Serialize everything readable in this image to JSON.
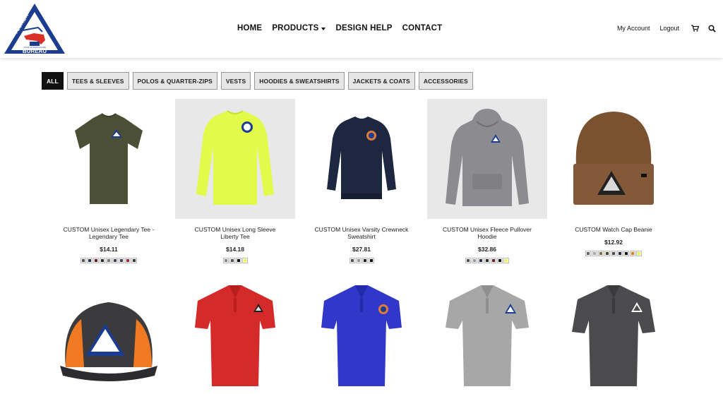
{
  "header": {
    "logo": {
      "top_text": "FLORIDA",
      "right_text": "FARM",
      "bottom_text": "BUREAU",
      "small_text": "VOICE OF AGRICULTURE"
    },
    "nav": [
      {
        "label": "HOME",
        "dropdown": false
      },
      {
        "label": "PRODUCTS",
        "dropdown": true
      },
      {
        "label": "DESIGN HELP",
        "dropdown": false
      },
      {
        "label": "CONTACT",
        "dropdown": false
      }
    ],
    "account_link": "My Account",
    "logout_link": "Logout",
    "cart_icon": "cart-icon",
    "search_icon": "search-icon"
  },
  "filters": [
    {
      "label": "ALL",
      "active": true
    },
    {
      "label": "TEES & SLEEVES",
      "active": false
    },
    {
      "label": "POLOS & QUARTER-ZIPS",
      "active": false
    },
    {
      "label": "VESTS",
      "active": false
    },
    {
      "label": "HOODIES & SWEATSHIRTS",
      "active": false
    },
    {
      "label": "JACKETS & COATS",
      "active": false
    },
    {
      "label": "ACCESSORIES",
      "active": false
    }
  ],
  "products": [
    {
      "name": "CUSTOM Unisex Legendary Tee - Legendary Tee",
      "price": "$14.11",
      "colors": [
        "#555555",
        "#23335a",
        "#6b1a1f",
        "#2d2d2d",
        "#777777",
        "#3a3f55",
        "#4a3f5c",
        "#b5252f",
        "#3b3b3b"
      ]
    },
    {
      "name": "CUSTOM Unisex Long Sleeve Liberty Tee",
      "price": "$14.18",
      "colors": [
        "#888888",
        "#555555",
        "#111111",
        "#e8ff3a"
      ]
    },
    {
      "name": "CUSTOM Unisex Varsity Crewneck Sweatshirt",
      "price": "$27.81",
      "colors": [
        "#555555",
        "#999999",
        "#222222",
        "#111111"
      ]
    },
    {
      "name": "CUSTOM Unisex Fleece Pullover Hoodie",
      "price": "$32.86",
      "colors": [
        "#555555",
        "#999999",
        "#23335a",
        "#2b2b2b",
        "#7a1c22",
        "#111111",
        "#e8ff3a"
      ]
    },
    {
      "name": "CUSTOM Watch Cap Beanie",
      "price": "$12.92",
      "colors": [
        "#666666",
        "#aaaaaa",
        "#8b6a4a",
        "#3e4a2c",
        "#4a4a4a",
        "#1f2a44",
        "#111111",
        "#ff7a1a",
        "#e8ff3a"
      ]
    },
    {
      "name": "",
      "price": "",
      "colors": []
    },
    {
      "name": "",
      "price": "",
      "colors": []
    },
    {
      "name": "",
      "price": "",
      "colors": []
    },
    {
      "name": "",
      "price": "",
      "colors": []
    },
    {
      "name": "",
      "price": "",
      "colors": []
    }
  ]
}
